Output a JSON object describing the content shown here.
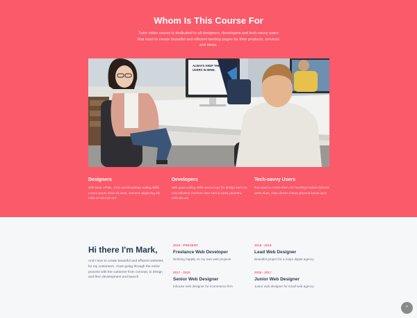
{
  "hero": {
    "title": "Whom Is This Course For",
    "subtitle": "Tutor video course is dedicated to all designers, developers and tech-savvy users that want to create beautiful and efficient landing pages for their products, services and ideas.",
    "photo_screen_text": "ALWAYS KEEP THE USERS IN MIND."
  },
  "audiences": [
    {
      "title": "Designers",
      "text": "with basic HTML, CSS and Bootstrap coding skills Lorem ipsum dolor sit amet, connect adipiscing elit nulla at nisl trah nor"
    },
    {
      "title": "Developers",
      "text": "with good coding skills and an eye for design Nam eu erat tellusest vivamus vitae sem in tortor pharetra vehicula ain"
    },
    {
      "title": "Tech-savvy Users",
      "text": "that want to create their own landings Nullam lobortis porta diam, vitae dictum metus placerat luctus lacin"
    }
  ],
  "about": {
    "title": "Hi there I'm Mark,",
    "text": "And I love to create beautiful and efficient websites for my customers. I love going through the entire process with the customer from concept, to design and then development and launch"
  },
  "experience": [
    {
      "period": "2019 - PRESENT",
      "title": "Freelance Web Developer",
      "desc": "Working happily on my own web projects"
    },
    {
      "period": "2016 - 2019",
      "title": "Lead Web Designer",
      "desc": "Beautiful project for a major digital agency"
    },
    {
      "period": "2017 - 2019",
      "title": "Senior Web Designer",
      "desc": "Inhouse web designer for ecommerce firm"
    },
    {
      "period": "2016 - 2017",
      "title": "Junior Web Designer",
      "desc": "Junior web designer for small web agency"
    }
  ],
  "back_to_top": {
    "icon": "chevron-up-icon",
    "glyph": "^"
  },
  "colors": {
    "accent": "#fb5a6a",
    "heading": "#2b3650",
    "light_bg": "#f6f7f9"
  }
}
